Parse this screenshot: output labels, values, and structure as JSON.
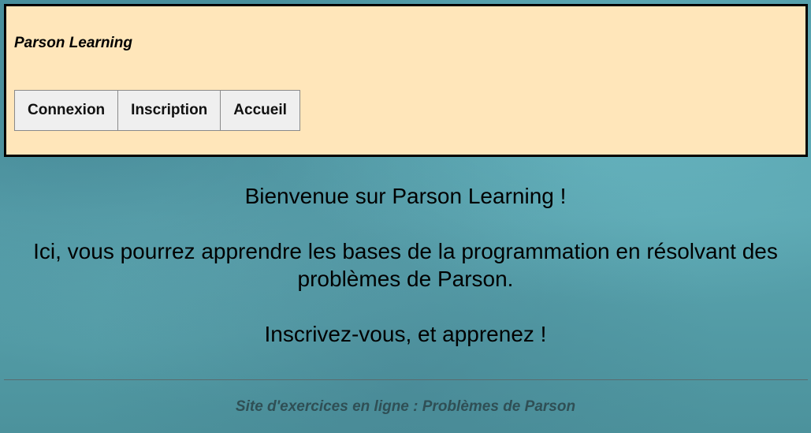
{
  "header": {
    "site_title": "Parson Learning",
    "nav": {
      "login_label": "Connexion",
      "register_label": "Inscription",
      "home_label": "Accueil"
    }
  },
  "main": {
    "welcome": "Bienvenue sur Parson Learning !",
    "intro": "Ici, vous pourrez apprendre les bases de la programmation en résolvant des problèmes de Parson.",
    "cta": "Inscrivez-vous, et apprenez !"
  },
  "footer": {
    "text": "Site d'exercices en ligne : Problèmes de Parson"
  },
  "colors": {
    "header_background": "#ffe6ba",
    "page_background": "#4f98a3",
    "footer_text": "#2f4f55"
  }
}
